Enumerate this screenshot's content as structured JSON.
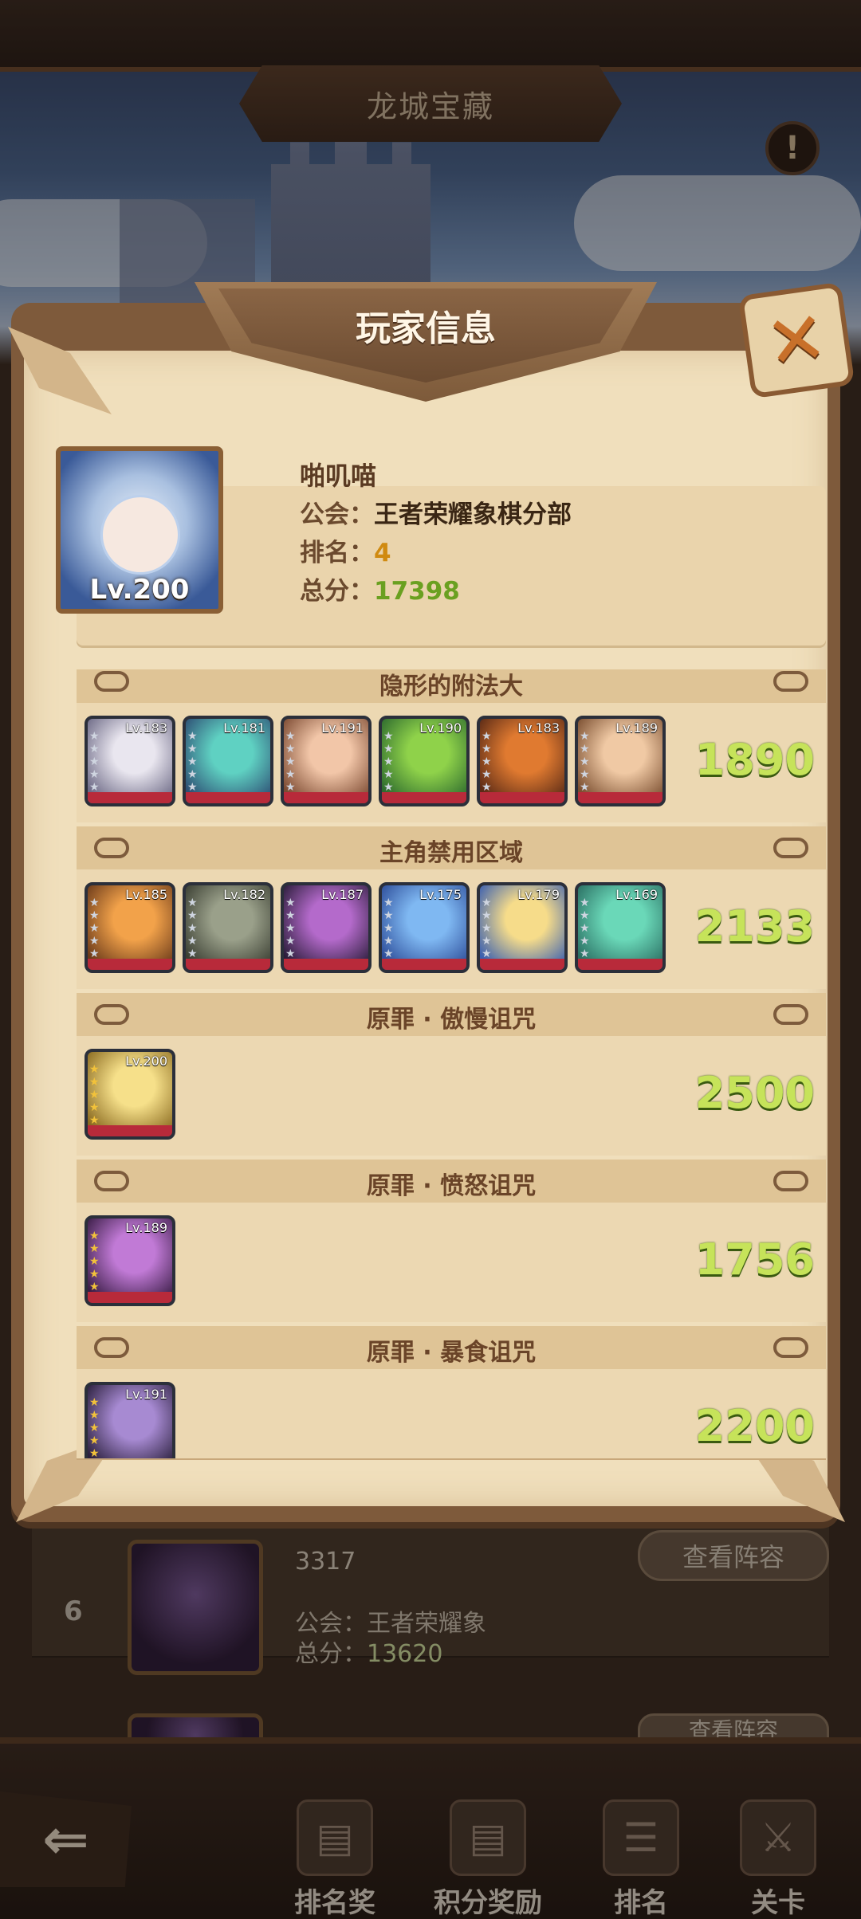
{
  "screen_title": "龙城宝藏",
  "modal": {
    "title": "玩家信息",
    "close_label": "✕"
  },
  "player": {
    "name": "啪叽喵",
    "level": "Lv.200",
    "guild_label": "公会：",
    "guild": "王者荣耀象棋分部",
    "rank_label": "排名：",
    "rank": "4",
    "score_label": "总分：",
    "score": "17398"
  },
  "teams": [
    {
      "title": "隐形的附法大",
      "score": "1890",
      "heroes": [
        {
          "level": "Lv.183",
          "colors": [
            "#e9e6ef",
            "#6d6a86"
          ],
          "gold": false
        },
        {
          "level": "Lv.181",
          "colors": [
            "#5fd1c2",
            "#2e4f74"
          ],
          "gold": false
        },
        {
          "level": "Lv.191",
          "colors": [
            "#f2c6a8",
            "#7c4a32"
          ],
          "gold": false
        },
        {
          "level": "Lv.190",
          "colors": [
            "#8fd24a",
            "#2d6a2e"
          ],
          "gold": false
        },
        {
          "level": "Lv.183",
          "colors": [
            "#e07a30",
            "#5a2a16"
          ],
          "gold": false
        },
        {
          "level": "Lv.189",
          "colors": [
            "#f0c9a4",
            "#7a4e30"
          ],
          "gold": false
        }
      ]
    },
    {
      "title": "主角禁用区域",
      "score": "2133",
      "heroes": [
        {
          "level": "Lv.185",
          "colors": [
            "#f2a24a",
            "#6b3a1a"
          ],
          "gold": false
        },
        {
          "level": "Lv.182",
          "colors": [
            "#9aa08a",
            "#3a3e32"
          ],
          "gold": false
        },
        {
          "level": "Lv.187",
          "colors": [
            "#b46acb",
            "#2b1d3a"
          ],
          "gold": false
        },
        {
          "level": "Lv.175",
          "colors": [
            "#7fb8f2",
            "#2e4e9a"
          ],
          "gold": false
        },
        {
          "level": "Lv.179",
          "colors": [
            "#f6dc8a",
            "#3a5fb0"
          ],
          "gold": false
        },
        {
          "level": "Lv.169",
          "colors": [
            "#6ad8b8",
            "#2a6e62"
          ],
          "gold": false
        }
      ]
    },
    {
      "title": "原罪 · 傲慢诅咒",
      "score": "2500",
      "heroes": [
        {
          "level": "Lv.200",
          "colors": [
            "#f6e08a",
            "#8a6a20"
          ],
          "gold": true
        }
      ]
    },
    {
      "title": "原罪 · 愤怒诅咒",
      "score": "1756",
      "heroes": [
        {
          "level": "Lv.189",
          "colors": [
            "#c17ad6",
            "#3a1d46"
          ],
          "gold": true
        }
      ]
    },
    {
      "title": "原罪 · 暴食诅咒",
      "score": "2200",
      "heroes": [
        {
          "level": "Lv.191",
          "colors": [
            "#a78ad2",
            "#2a1f3c"
          ],
          "gold": true
        }
      ]
    }
  ],
  "background_list": {
    "rank": "6",
    "name": "3317",
    "guild_label": "公会：",
    "guild": "王者荣耀象",
    "score_label": "总分：",
    "score": "13620",
    "view_lineup": "查看阵容",
    "view_lineup_2": "查看阵容"
  },
  "bottom_nav": {
    "back_icon": "back-arrow-icon",
    "items": [
      {
        "label": "排名奖",
        "icon": "rank-reward-icon"
      },
      {
        "label": "积分奖励",
        "icon": "points-reward-icon"
      },
      {
        "label": "排名",
        "icon": "ranking-icon"
      },
      {
        "label": "关卡",
        "icon": "stage-icon"
      }
    ]
  },
  "colors": {
    "score_green": "#c6e35a",
    "rank_orange": "#d08a10",
    "panel": "#f0dfbc"
  }
}
